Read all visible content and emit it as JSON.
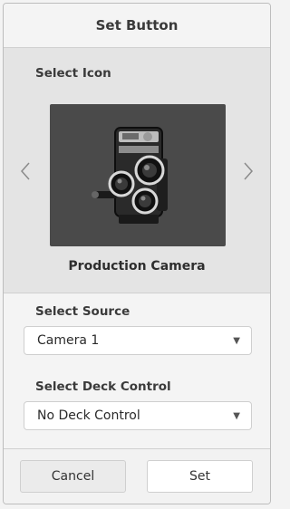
{
  "dialog": {
    "title": "Set Button"
  },
  "icon_panel": {
    "label": "Select Icon",
    "icon": "production-camera-icon",
    "icon_name": "Production Camera",
    "prev_arrow": "‹",
    "next_arrow": "›"
  },
  "source": {
    "label": "Select Source",
    "value": "Camera 1"
  },
  "deck_control": {
    "label": "Select Deck Control",
    "value": "No Deck Control"
  },
  "buttons": {
    "cancel": "Cancel",
    "set": "Set"
  },
  "colors": {
    "preview_background": "#4a4a4a",
    "panel_background": "#e4e4e4"
  }
}
